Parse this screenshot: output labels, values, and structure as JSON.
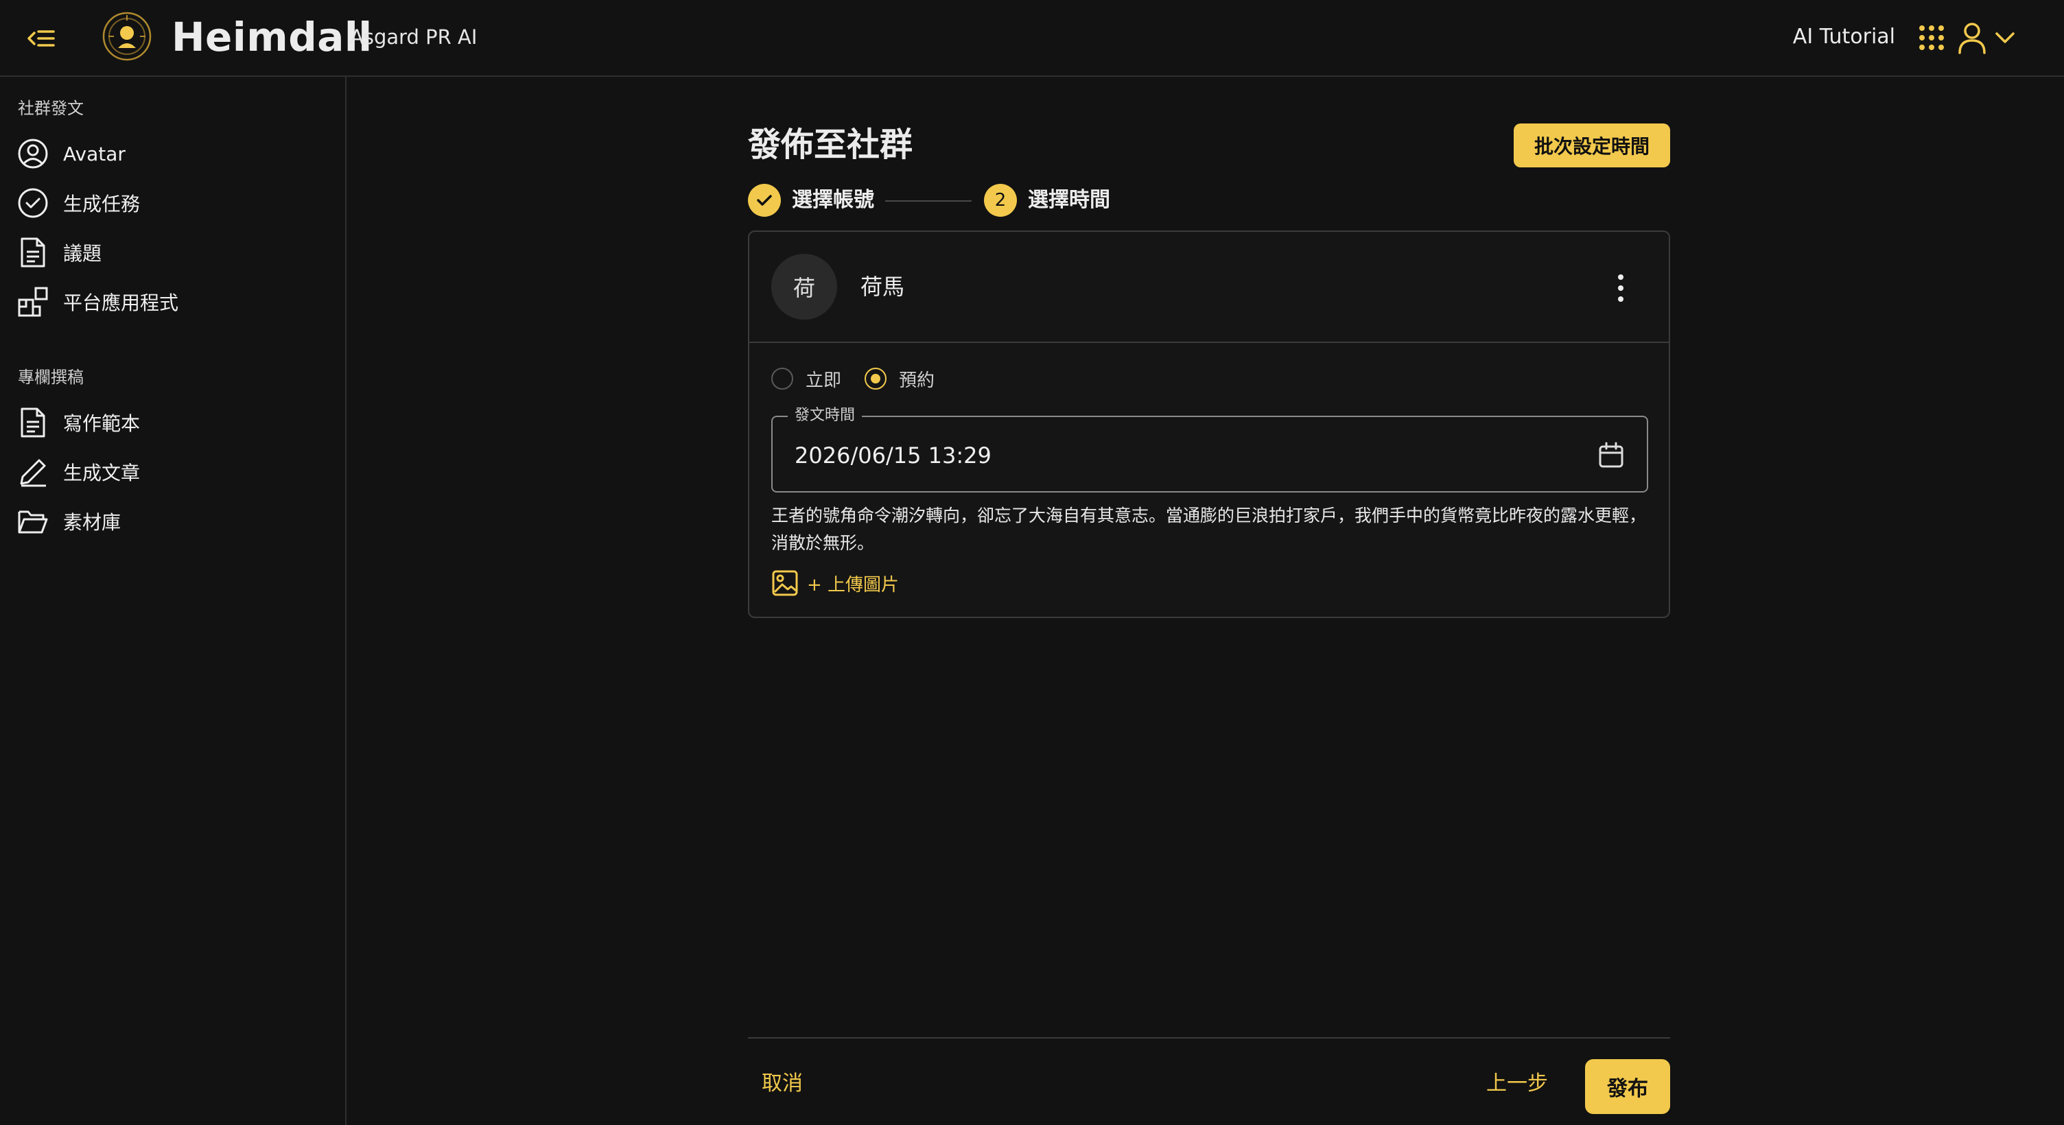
{
  "header": {
    "brand": "Heimdall",
    "subbrand": "Asgard PR AI",
    "tutorial": "AI Tutorial",
    "icons": {
      "menu": "menu-collapse-icon",
      "logo": "heimdall-logo-icon",
      "apps": "apps-grid-icon",
      "user": "user-icon",
      "chevron": "chevron-down-icon"
    }
  },
  "sidebar": {
    "sections": [
      {
        "title": "社群發文",
        "items": [
          {
            "label": "Avatar",
            "icon": "user-circle-icon"
          },
          {
            "label": "生成任務",
            "icon": "check-circle-icon"
          },
          {
            "label": "議題",
            "icon": "document-icon"
          },
          {
            "label": "平台應用程式",
            "icon": "apps-icon"
          }
        ]
      },
      {
        "title": "專欄撰稿",
        "items": [
          {
            "label": "寫作範本",
            "icon": "document-icon"
          },
          {
            "label": "生成文章",
            "icon": "pen-icon"
          },
          {
            "label": "素材庫",
            "icon": "folder-icon"
          }
        ]
      }
    ]
  },
  "main": {
    "title": "發佈至社群",
    "batch_button": "批次設定時間",
    "steps": [
      {
        "label": "選擇帳號",
        "status": "done"
      },
      {
        "label": "選擇時間",
        "number": "2",
        "status": "active"
      }
    ],
    "account": {
      "avatar_text": "荷",
      "name": "荷馬"
    },
    "schedule": {
      "options": [
        {
          "label": "立即",
          "selected": false
        },
        {
          "label": "預約",
          "selected": true
        }
      ],
      "field_label": "發文時間",
      "value": "2026/06/15 13:29"
    },
    "post_text": "王者的號角命令潮汐轉向，卻忘了大海自有其意志。當通膨的巨浪拍打家戶，我們手中的貨幣竟比昨夜的露水更輕，消散於無形。",
    "upload_label": "+ 上傳圖片"
  },
  "footer": {
    "cancel": "取消",
    "prev": "上一步",
    "publish": "發布"
  },
  "colors": {
    "accent": "#f2c94c",
    "background": "#121212"
  }
}
